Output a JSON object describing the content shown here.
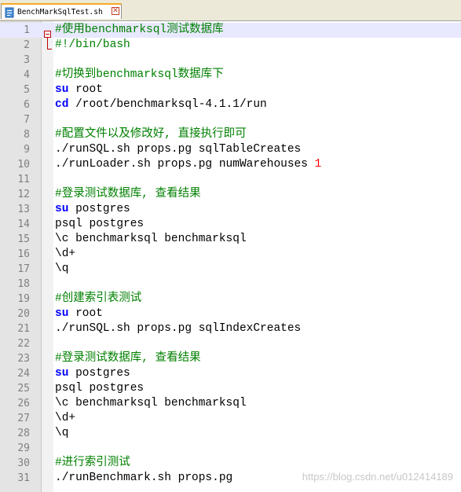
{
  "tab": {
    "title": "BenchMarkSqlTest.sh",
    "icon": "file-icon",
    "close_icon": "close-icon"
  },
  "lines": [
    {
      "n": "1",
      "parts": [
        {
          "t": "#使用benchmarksql测试数据库",
          "c": "comment"
        }
      ]
    },
    {
      "n": "2",
      "parts": [
        {
          "t": "#!/bin/bash",
          "c": "comment"
        }
      ]
    },
    {
      "n": "3",
      "parts": []
    },
    {
      "n": "4",
      "parts": [
        {
          "t": "#切换到benchmarksql数据库下",
          "c": "comment"
        }
      ]
    },
    {
      "n": "5",
      "parts": [
        {
          "t": "su",
          "c": "kw"
        },
        {
          "t": " root",
          "c": ""
        }
      ]
    },
    {
      "n": "6",
      "parts": [
        {
          "t": "cd",
          "c": "kw"
        },
        {
          "t": " /root/benchmarksql-4.1.1/run",
          "c": ""
        }
      ]
    },
    {
      "n": "7",
      "parts": []
    },
    {
      "n": "8",
      "parts": [
        {
          "t": "#配置文件以及修改好, 直接执行即可",
          "c": "comment"
        }
      ]
    },
    {
      "n": "9",
      "parts": [
        {
          "t": "./runSQL.sh props.pg sqlTableCreates",
          "c": ""
        }
      ]
    },
    {
      "n": "10",
      "parts": [
        {
          "t": "./runLoader.sh props.pg numWarehouses ",
          "c": ""
        },
        {
          "t": "1",
          "c": "num"
        }
      ]
    },
    {
      "n": "11",
      "parts": []
    },
    {
      "n": "12",
      "parts": [
        {
          "t": "#登录测试数据库, 查看结果",
          "c": "comment"
        }
      ]
    },
    {
      "n": "13",
      "parts": [
        {
          "t": "su",
          "c": "kw"
        },
        {
          "t": " postgres",
          "c": ""
        }
      ]
    },
    {
      "n": "14",
      "parts": [
        {
          "t": "psql postgres",
          "c": ""
        }
      ]
    },
    {
      "n": "15",
      "parts": [
        {
          "t": "\\c benchmarksql benchmarksql",
          "c": ""
        }
      ]
    },
    {
      "n": "16",
      "parts": [
        {
          "t": "\\d+",
          "c": ""
        }
      ]
    },
    {
      "n": "17",
      "parts": [
        {
          "t": "\\q",
          "c": ""
        }
      ]
    },
    {
      "n": "18",
      "parts": []
    },
    {
      "n": "19",
      "parts": [
        {
          "t": "#创建索引表测试",
          "c": "comment"
        }
      ]
    },
    {
      "n": "20",
      "parts": [
        {
          "t": "su",
          "c": "kw"
        },
        {
          "t": " root",
          "c": ""
        }
      ]
    },
    {
      "n": "21",
      "parts": [
        {
          "t": "./runSQL.sh props.pg sqlIndexCreates",
          "c": ""
        }
      ]
    },
    {
      "n": "22",
      "parts": []
    },
    {
      "n": "23",
      "parts": [
        {
          "t": "#登录测试数据库, 查看结果",
          "c": "comment"
        }
      ]
    },
    {
      "n": "24",
      "parts": [
        {
          "t": "su",
          "c": "kw"
        },
        {
          "t": " postgres",
          "c": ""
        }
      ]
    },
    {
      "n": "25",
      "parts": [
        {
          "t": "psql postgres",
          "c": ""
        }
      ]
    },
    {
      "n": "26",
      "parts": [
        {
          "t": "\\c benchmarksql benchmarksql",
          "c": ""
        }
      ]
    },
    {
      "n": "27",
      "parts": [
        {
          "t": "\\d+",
          "c": ""
        }
      ]
    },
    {
      "n": "28",
      "parts": [
        {
          "t": "\\q",
          "c": ""
        }
      ]
    },
    {
      "n": "29",
      "parts": []
    },
    {
      "n": "30",
      "parts": [
        {
          "t": "#进行索引测试",
          "c": "comment"
        }
      ]
    },
    {
      "n": "31",
      "parts": [
        {
          "t": "./runBenchmark.sh props.pg",
          "c": ""
        }
      ]
    }
  ],
  "watermark": "https://blog.csdn.net/u012414189",
  "colors": {
    "comment": "#008000",
    "keyword": "#0000ff",
    "number": "#ff0000",
    "current_line": "#e8e8ff"
  }
}
